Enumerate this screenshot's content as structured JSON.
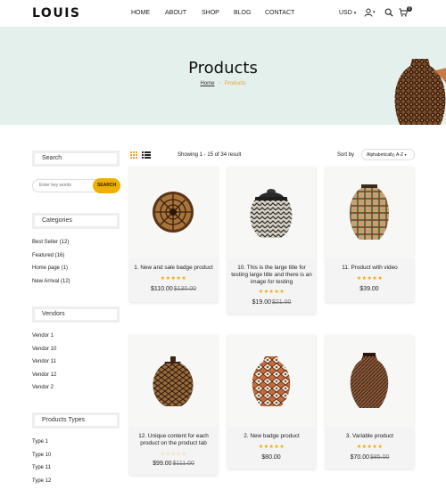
{
  "header": {
    "logo": "LOUIS",
    "nav": [
      "HOME",
      "ABOUT",
      "SHOP",
      "BLOG",
      "CONTACT"
    ],
    "currency": "USD",
    "cart_count": "0"
  },
  "hero": {
    "title": "Products",
    "breadcrumb_home": "Home",
    "breadcrumb_current": "Products"
  },
  "sidebar": {
    "search_title": "Search",
    "search_placeholder": "Enter key words",
    "search_button": "SEARCH",
    "categories_title": "Categories",
    "categories": [
      "Best Seller (12)",
      "Featured (16)",
      "Home page (1)",
      "New Arrival (12)"
    ],
    "vendors_title": "Vendors",
    "vendors": [
      "Vendor 1",
      "Vendor 10",
      "Vendor 11",
      "Vendor 12",
      "Vendor 2"
    ],
    "types_title": "Products Types",
    "types": [
      "Type 1",
      "Type 10",
      "Type 11",
      "Type 12"
    ]
  },
  "toolbar": {
    "showing": "Showing 1 - 15 of 34 result",
    "sort_label": "Sort by",
    "sort_value": "Alphabetically, A-Z"
  },
  "products": [
    {
      "title": "1. New and sale badge product",
      "rating": 4.5,
      "price": "$110.00",
      "old_price": "$130.00"
    },
    {
      "title": "10. This is the large title for testing large title and there is an image for testing",
      "rating": 4.5,
      "price": "$19.00",
      "old_price": "$21.00"
    },
    {
      "title": "11. Product with video",
      "rating": 5,
      "price": "$39.00",
      "old_price": ""
    },
    {
      "title": "12. Unique content for each product on the product tab",
      "rating": 0,
      "price": "$99.00",
      "old_price": "$111.00"
    },
    {
      "title": "2. New badge product",
      "rating": 5,
      "price": "$80.00",
      "old_price": ""
    },
    {
      "title": "3. Variable product",
      "rating": 4.5,
      "price": "$70.00",
      "old_price": "$85.00"
    }
  ],
  "colors": {
    "hero_bg": "#e4f0ec",
    "accent": "#f0b000",
    "breadcrumb_current": "#e8a33d",
    "star": "#f0a800"
  }
}
